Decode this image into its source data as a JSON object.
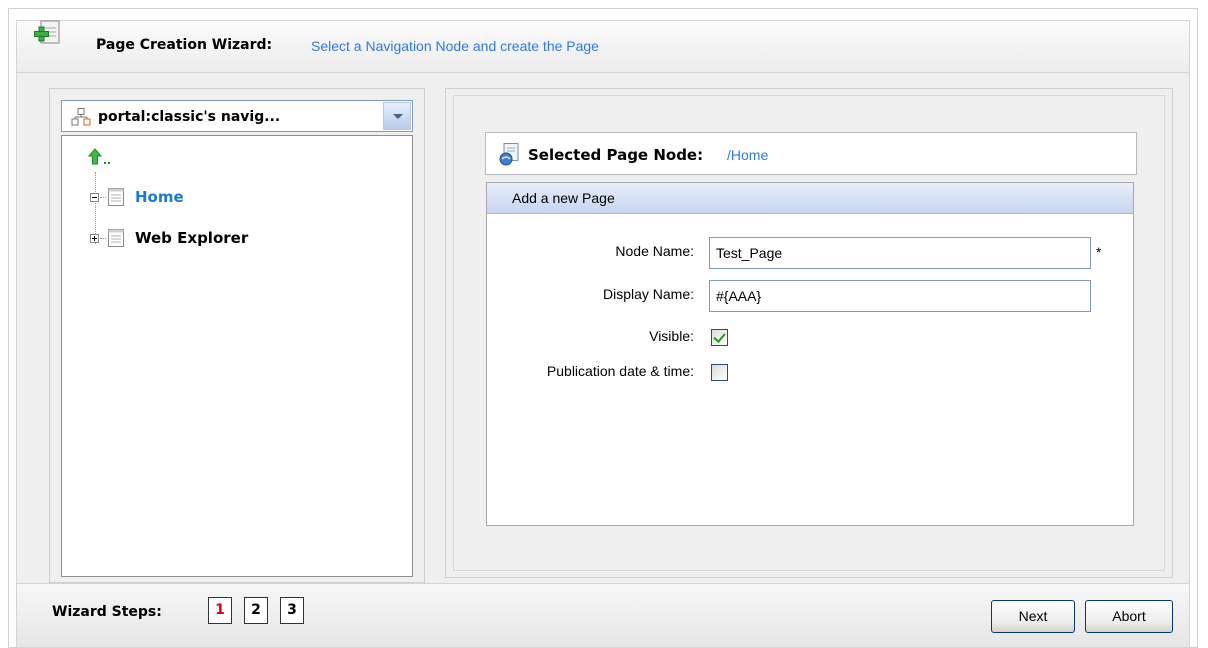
{
  "header": {
    "title": "Page Creation Wizard:",
    "subtitle": "Select a Navigation Node and create the Page",
    "icon": "add-page-icon"
  },
  "navigation": {
    "selector_label": "portal:classic's navig...",
    "selector_icon": "navigation-tree-icon",
    "up_icon": "level-up-icon",
    "tree": [
      {
        "label": "Home",
        "expanded": true,
        "selected": true
      },
      {
        "label": "Web Explorer",
        "expanded": false,
        "selected": false
      }
    ]
  },
  "selected_node": {
    "label": "Selected Page Node:",
    "value": "/Home",
    "icon": "page-node-icon"
  },
  "form": {
    "title": "Add a new Page",
    "node_name_label": "Node Name:",
    "node_name_value": "Test_Page",
    "required_mark": "*",
    "display_name_label": "Display Name:",
    "display_name_value": "#{AAA}",
    "visible_label": "Visible:",
    "visible_checked": true,
    "publication_label": "Publication date & time:",
    "publication_checked": false
  },
  "footer": {
    "steps_label": "Wizard Steps:",
    "steps": [
      "1",
      "2",
      "3"
    ],
    "active_step": "1",
    "next_label": "Next",
    "abort_label": "Abort"
  },
  "colors": {
    "link": "#2e7ae0",
    "active_step": "#e00000",
    "form_header": "#c7d5f0"
  }
}
